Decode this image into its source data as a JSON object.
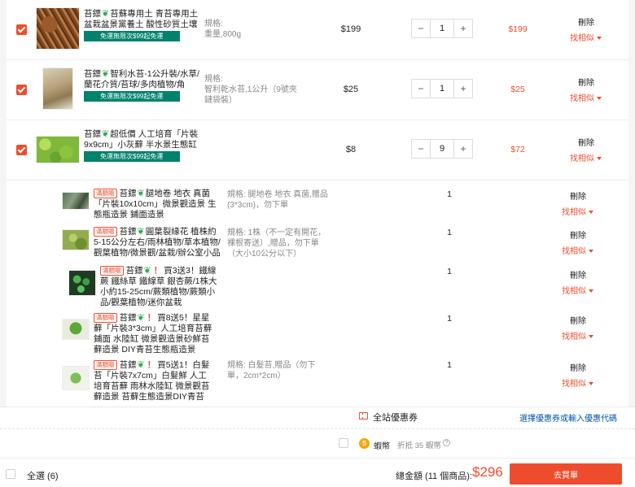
{
  "products": [
    {
      "title": "苔鏢 苔蘇專用土 青苔專用土 盆栽盆景黨養土 酸性砂質土壤 ...",
      "title_prefix": "苔鏢",
      "title_rest": "苔蘇專用土 青苔專用土 盆栽盆景黨養土 酸性砂質土壤 ...",
      "badge": "免運無限次$99起免運",
      "spec_label": "規格:",
      "spec_value": "重量,800g",
      "unit_price": "$199",
      "quantity": "1",
      "subtotal": "$199",
      "delete": "刪除",
      "similar": "找相似"
    },
    {
      "title_prefix": "苔鏢",
      "title_rest": "智利水苔-1公升裝/水草/蘭花介質/苔球/多肉植物/角蛙/...",
      "badge": "免運無限次$99起免運",
      "spec_label": "規格:",
      "spec_value": "智利乾水苔,1公升（9號夾鏈袋裝）",
      "unit_price": "$25",
      "quantity": "1",
      "subtotal": "$25",
      "delete": "刪除",
      "similar": "找相似"
    },
    {
      "title_prefix": "苔鏢",
      "title_rest": "超低價 人工培育「片裝9x9cm」小灰蘚 半水景生態缸 青...",
      "badge": "免運無限次$99起免運",
      "spec_label": "",
      "spec_value": "",
      "unit_price": "$8",
      "quantity": "9",
      "subtotal": "$72",
      "delete": "刪除",
      "similar": "找相似"
    }
  ],
  "gifts": [
    {
      "tag": "滿額贈",
      "title_prefix": "苔鏢",
      "title_rest": "腿地卷 地衣 真菌「片裝10x10cm」微景觀造景 生態瓶造景 鋪面造景",
      "spec": "規格: 腿地卷 地衣 真菌,贈品(3*3cm)，勿下單",
      "quantity": "1",
      "delete": "刪除",
      "similar": "找相似"
    },
    {
      "tag": "滿額贈",
      "title_prefix": "苔鏢",
      "title_rest": "圓葉裂緣花 植株約5-15公分左右/雨林植物/草本植物/觀葉植物/微景觀/盆栽/辦公室小品",
      "spec": "規格: 1株（不一定有開花，裸根寄送）,贈品，勿下單（大小10公分以下）",
      "quantity": "1",
      "delete": "刪除",
      "similar": "找相似"
    },
    {
      "tag": "滿額贈",
      "title_prefix": "苔鏢",
      "excl": "！",
      "title_rest": "買3送3！鐵線蕨 鐵絲草 鐵線草 銀杏蕨/1株大小約15-25cm/蕨類植物/蕨類小品/觀葉植物/迷你盆栽",
      "spec": "",
      "quantity": "1",
      "delete": "刪除",
      "similar": "找相似"
    },
    {
      "tag": "滿額贈",
      "title_prefix": "苔鏢",
      "excl": "！",
      "title_rest": "買8送5！星星蘚「片裝3*3cm」人工培育苔蘚 鋪面 水陸缸 微景觀造景砂鮮苔蘚造景 DIY青苔生態瓶造景",
      "spec": "",
      "quantity": "1",
      "delete": "刪除",
      "similar": "找相似"
    },
    {
      "tag": "滿額贈",
      "title_prefix": "苔鏢",
      "excl": "！",
      "title_rest": "買5送1！白髮苔「片裝7x7cm」白髮鮮 人工培育苔蘚 雨林水陸缸 微景觀苔蘚造景 苔蘚生態造景DIY青苔",
      "spec": "規格: 白髮苔,贈品（勿下單，2cm*2cm）",
      "quantity": "1",
      "delete": "刪除",
      "similar": "找相似"
    }
  ],
  "footer": {
    "voucher_label": "全站優惠券",
    "voucher_link": "選擇優惠券或輸入優惠代碼",
    "coin_icon": "S",
    "coin_label": "蝦幣",
    "coin_hint": "折抵 35 蝦幣",
    "help_icon": "?",
    "select_all": "全選 (6)",
    "total_label": "總金額 (11 個商品):",
    "total_value": "$296",
    "checkout": "去買單"
  },
  "colors": {
    "accent": "#ee4d2d",
    "badge": "#00826c",
    "link": "#0055aa",
    "leaf": "#2aa84a"
  },
  "icons": {
    "leaf": "leaf-icon",
    "caret": "caret-down-icon",
    "voucher": "voucher-icon",
    "coin": "shopee-coin-icon",
    "help": "help-icon"
  }
}
